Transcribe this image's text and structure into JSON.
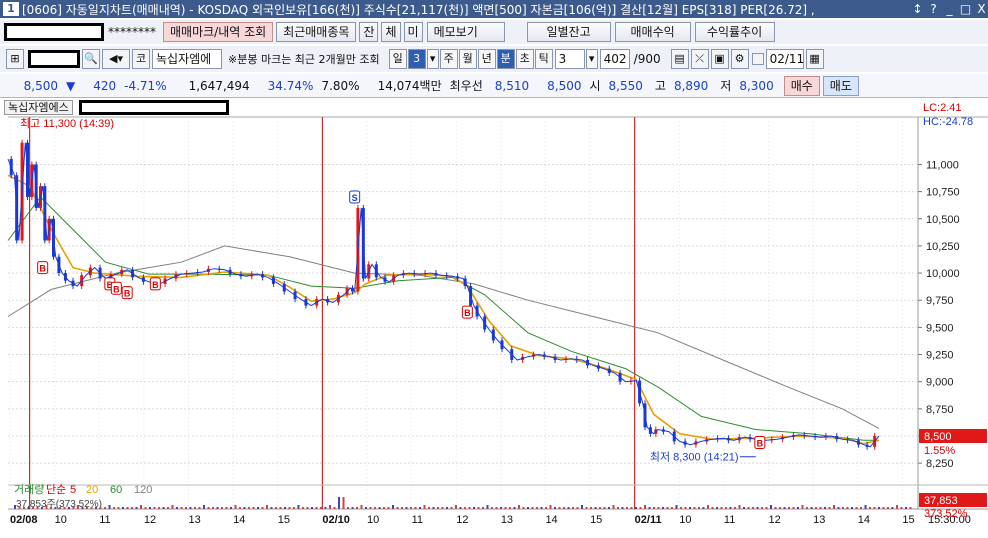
{
  "window": {
    "number": "1",
    "title": "[0606] 자동일지차트(매매내역) - KOSDAQ 외국인보유[166(천)] 주식수[21,117(천)] 액면[500] 자본금[106(억)] 결산[12월] EPS[318] PER[26.72] ,",
    "buttons": [
      "↕",
      "?",
      "_",
      "□",
      "X"
    ]
  },
  "toolbar1": {
    "account_mask": "********",
    "btn_trade_mark": "매매마크/내역 조회",
    "btn_recent_trades": "최근매매종목",
    "btn_jan": "잔",
    "btn_che": "체",
    "btn_mi": "미",
    "btn_memo": "메모보기",
    "btn_daily_balance": "일별잔고",
    "btn_trade_profit": "매매수익",
    "btn_profit_trend": "수익률추이"
  },
  "toolbar2": {
    "code_prefix": "코",
    "stock_name": "녹십자엠에",
    "note": "※분봉 마크는 최근 2개월만 조회",
    "period_labels": [
      "일",
      "3",
      "주",
      "월",
      "년",
      "분",
      "초",
      "틱"
    ],
    "interval_value": "3",
    "count_value": "402",
    "count_total": "/900",
    "date_value": "02/11"
  },
  "quote": {
    "price": "8,500",
    "arrow": "▼",
    "change": "420",
    "change_pct": "-4.71%",
    "volume": "1,647,494",
    "vol_ratio": "34.74%",
    "turnover": "7.80%",
    "trade_amount": "14,074백만",
    "best_ask_label": "최우선",
    "best_ask": "8,510",
    "best_bid": "8,500",
    "open_label": "시",
    "open": "8,550",
    "high_label": "고",
    "high": "8,890",
    "low_label": "저",
    "low": "8,300",
    "buy_label": "매수",
    "sell_label": "매도"
  },
  "chart_header": {
    "tab_name": "녹십자엠에스"
  },
  "chart_data": {
    "type": "line",
    "title": "",
    "y_axis_ticks": [
      11000,
      10750,
      10500,
      10250,
      10000,
      9750,
      9500,
      9250,
      9000,
      8750,
      8500,
      8250
    ],
    "y_tick_labels": [
      "11,000",
      "10,750",
      "10,500",
      "10,250",
      "10,000",
      "9,750",
      "9,500",
      "9,250",
      "9,000",
      "8,750",
      "8,500",
      "8,250"
    ],
    "ylim": [
      8150,
      11400
    ],
    "x_tick_labels": [
      "02/08",
      "10",
      "11",
      "12",
      "13",
      "14",
      "15",
      "02/10",
      "10",
      "11",
      "12",
      "13",
      "14",
      "15",
      "02/11",
      "10",
      "11",
      "12",
      "13",
      "14",
      "15",
      "15:30:00"
    ],
    "session_dividers": [
      "02/10",
      "02/11"
    ],
    "lc_label": "LC:2.41",
    "hc_label": "HC:-24.78",
    "high_annotation": "최고 11,300 (14:39)",
    "low_annotation": "최저 8,300 (14:21)",
    "current_price_label": "8,500",
    "current_pct_label": "1.55%",
    "ma_labels": {
      "name": "거래량",
      "type": "단순",
      "p5": "5",
      "p20": "20",
      "p60": "60",
      "p120": "120"
    },
    "volume_label": "37,853",
    "volume_pct_label": "373.52%",
    "volume_overlay_text": "37,853주(373.52%)",
    "colors": {
      "up": "#e01818",
      "down": "#1a38d6",
      "ma5": "#e8a000",
      "ma20": "#2e8b2e",
      "ma60": "#808080",
      "divider": "#d00000"
    },
    "price_path": [
      [
        0,
        11050
      ],
      [
        3,
        10900
      ],
      [
        5,
        10300
      ],
      [
        8,
        11200
      ],
      [
        10,
        10700
      ],
      [
        12,
        11000
      ],
      [
        14,
        10600
      ],
      [
        16,
        10800
      ],
      [
        18,
        10300
      ],
      [
        20,
        10500
      ],
      [
        22,
        10150
      ],
      [
        25,
        10000
      ],
      [
        28,
        9930
      ],
      [
        32,
        9880
      ],
      [
        36,
        9980
      ],
      [
        40,
        10050
      ],
      [
        45,
        9950
      ],
      [
        50,
        9990
      ],
      [
        55,
        10030
      ],
      [
        60,
        9960
      ],
      [
        65,
        9920
      ],
      [
        70,
        9900
      ],
      [
        75,
        9950
      ],
      [
        80,
        9990
      ],
      [
        85,
        10000
      ],
      [
        90,
        10010
      ],
      [
        95,
        10040
      ],
      [
        100,
        10030
      ],
      [
        105,
        9990
      ],
      [
        110,
        9970
      ],
      [
        115,
        9990
      ],
      [
        120,
        9960
      ],
      [
        125,
        9900
      ],
      [
        130,
        9830
      ],
      [
        135,
        9760
      ],
      [
        140,
        9700
      ],
      [
        145,
        9760
      ],
      [
        150,
        9730
      ],
      [
        155,
        9800
      ],
      [
        158,
        9860
      ],
      [
        160,
        9830
      ],
      [
        163,
        10600
      ],
      [
        165,
        9950
      ],
      [
        168,
        10080
      ],
      [
        172,
        9960
      ],
      [
        176,
        9920
      ],
      [
        180,
        9980
      ],
      [
        185,
        10000
      ],
      [
        190,
        9990
      ],
      [
        195,
        10000
      ],
      [
        200,
        9980
      ],
      [
        205,
        9970
      ],
      [
        210,
        9950
      ],
      [
        212,
        9880
      ],
      [
        215,
        9700
      ],
      [
        218,
        9600
      ],
      [
        222,
        9480
      ],
      [
        226,
        9380
      ],
      [
        230,
        9300
      ],
      [
        235,
        9200
      ],
      [
        240,
        9230
      ],
      [
        245,
        9250
      ],
      [
        250,
        9230
      ],
      [
        255,
        9200
      ],
      [
        260,
        9210
      ],
      [
        265,
        9200
      ],
      [
        270,
        9150
      ],
      [
        275,
        9120
      ],
      [
        280,
        9080
      ],
      [
        285,
        9000
      ],
      [
        290,
        9010
      ],
      [
        293,
        8800
      ],
      [
        295,
        8580
      ],
      [
        298,
        8520
      ],
      [
        300,
        8560
      ],
      [
        305,
        8540
      ],
      [
        310,
        8450
      ],
      [
        315,
        8420
      ],
      [
        320,
        8450
      ],
      [
        325,
        8470
      ],
      [
        330,
        8480
      ],
      [
        335,
        8460
      ],
      [
        340,
        8490
      ],
      [
        345,
        8470
      ],
      [
        350,
        8460
      ],
      [
        355,
        8470
      ],
      [
        360,
        8490
      ],
      [
        365,
        8510
      ],
      [
        370,
        8500
      ],
      [
        375,
        8490
      ],
      [
        380,
        8500
      ],
      [
        385,
        8470
      ],
      [
        390,
        8460
      ],
      [
        395,
        8420
      ],
      [
        398,
        8400
      ],
      [
        402,
        8500
      ]
    ],
    "ma5_path": [
      [
        0,
        10900
      ],
      [
        10,
        10800
      ],
      [
        20,
        10400
      ],
      [
        30,
        10050
      ],
      [
        40,
        10000
      ],
      [
        60,
        9970
      ],
      [
        80,
        9960
      ],
      [
        100,
        10010
      ],
      [
        120,
        9980
      ],
      [
        130,
        9870
      ],
      [
        140,
        9740
      ],
      [
        150,
        9760
      ],
      [
        160,
        9820
      ],
      [
        165,
        9900
      ],
      [
        175,
        9980
      ],
      [
        190,
        9990
      ],
      [
        205,
        9970
      ],
      [
        212,
        9880
      ],
      [
        222,
        9560
      ],
      [
        232,
        9330
      ],
      [
        245,
        9240
      ],
      [
        260,
        9210
      ],
      [
        275,
        9130
      ],
      [
        290,
        9020
      ],
      [
        298,
        8700
      ],
      [
        310,
        8520
      ],
      [
        325,
        8470
      ],
      [
        345,
        8480
      ],
      [
        365,
        8500
      ],
      [
        385,
        8480
      ],
      [
        395,
        8430
      ],
      [
        402,
        8460
      ]
    ],
    "ma20_path": [
      [
        0,
        10300
      ],
      [
        15,
        10700
      ],
      [
        30,
        10400
      ],
      [
        45,
        10100
      ],
      [
        65,
        9990
      ],
      [
        90,
        9990
      ],
      [
        120,
        9980
      ],
      [
        140,
        9880
      ],
      [
        160,
        9860
      ],
      [
        180,
        9930
      ],
      [
        205,
        9960
      ],
      [
        220,
        9800
      ],
      [
        240,
        9450
      ],
      [
        260,
        9280
      ],
      [
        285,
        9120
      ],
      [
        300,
        8950
      ],
      [
        320,
        8680
      ],
      [
        345,
        8560
      ],
      [
        370,
        8520
      ],
      [
        395,
        8460
      ],
      [
        402,
        8460
      ]
    ],
    "ma60_path": [
      [
        0,
        9600
      ],
      [
        20,
        9850
      ],
      [
        50,
        10000
      ],
      [
        80,
        10100
      ],
      [
        100,
        10250
      ],
      [
        130,
        10150
      ],
      [
        160,
        10000
      ],
      [
        190,
        9980
      ],
      [
        215,
        9900
      ],
      [
        240,
        9750
      ],
      [
        270,
        9600
      ],
      [
        300,
        9450
      ],
      [
        330,
        9200
      ],
      [
        360,
        8950
      ],
      [
        385,
        8750
      ],
      [
        402,
        8570
      ]
    ],
    "trade_markers": [
      {
        "label": "B",
        "x": 16,
        "price": 10050
      },
      {
        "label": "B",
        "x": 47,
        "price": 9900
      },
      {
        "label": "B",
        "x": 50,
        "price": 9860
      },
      {
        "label": "B",
        "x": 55,
        "price": 9820
      },
      {
        "label": "B",
        "x": 68,
        "price": 9900
      },
      {
        "label": "S",
        "x": 160,
        "price": 10700
      },
      {
        "label": "B",
        "x": 212,
        "price": 9640
      },
      {
        "label": "B",
        "x": 347,
        "price": 8440
      }
    ]
  }
}
